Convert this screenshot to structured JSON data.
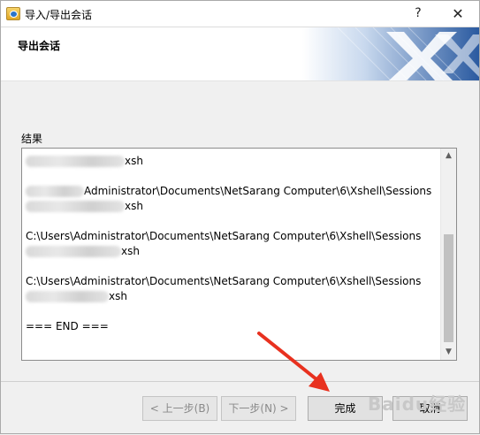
{
  "window": {
    "title": "导入/导出会话",
    "help_glyph": "?",
    "close_glyph": "✕"
  },
  "header": {
    "title": "导出会话"
  },
  "result": {
    "label": "结果",
    "lines": [
      {
        "prefix": "",
        "text": "xsh",
        "redacted": true
      },
      {
        "prefix": "",
        "text": "",
        "gap": true
      },
      {
        "prefix": "C:\\Users\\",
        "text": "Administrator\\Documents\\NetSarang Computer\\6\\Xshell\\Sessions",
        "redacted_prefix": true
      },
      {
        "prefix": "\\192.168.20",
        "text": "xsh",
        "redacted": true
      },
      {
        "prefix": "",
        "text": "",
        "gap": true
      },
      {
        "prefix": "C:\\Users\\",
        "text": "Administrator\\Documents\\NetSarang Computer\\6\\Xshell\\Sessions"
      },
      {
        "prefix": "",
        "text": "xsh",
        "redacted": true
      },
      {
        "prefix": "",
        "text": "",
        "gap": true
      },
      {
        "prefix": "C:\\Users\\",
        "text": "Administrator\\Documents\\NetSarang Computer\\6\\Xshell\\Sessions"
      },
      {
        "prefix": "",
        "text": "xsh",
        "redacted": true
      },
      {
        "prefix": "",
        "text": "",
        "gap": true
      },
      {
        "prefix": "",
        "text": "=== END ==="
      }
    ],
    "end_marker": "=== END ==="
  },
  "buttons": {
    "prev": "< 上一步(B)",
    "next": "下一步(N) >",
    "finish": "完成",
    "cancel": "取消"
  },
  "watermark": "Baidu经验",
  "colors": {
    "arrow": "#e8311f",
    "banner": "#1e4a8a"
  }
}
